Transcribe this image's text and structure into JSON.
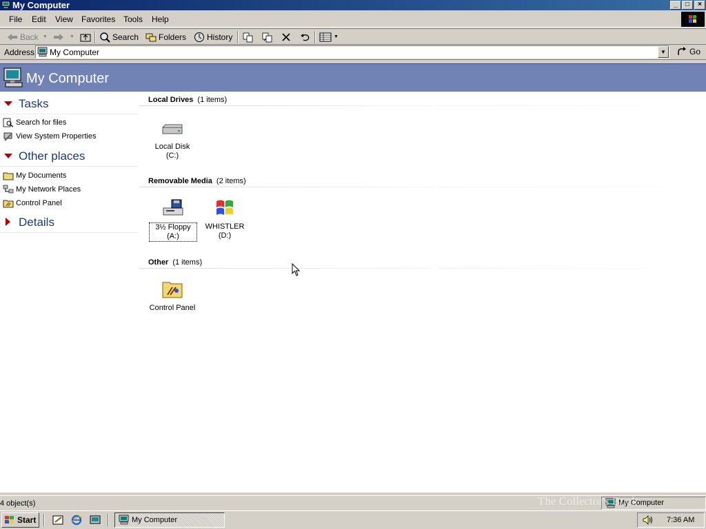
{
  "window": {
    "title": "My Computer",
    "min_label": "_",
    "max_label": "□",
    "close_label": "×"
  },
  "menu": [
    "File",
    "Edit",
    "View",
    "Favorites",
    "Tools",
    "Help"
  ],
  "toolbar": {
    "back_label": "Back",
    "search_label": "Search",
    "folders_label": "Folders",
    "history_label": "History"
  },
  "address": {
    "label": "Address",
    "value": "My Computer",
    "go_label": "Go"
  },
  "banner": {
    "title": "My Computer"
  },
  "sidebar": {
    "tasks_header": "Tasks",
    "tasks": [
      "Search for files",
      "View System Properties"
    ],
    "other_header": "Other places",
    "other": [
      "My Documents",
      "My Network Places",
      "Control Panel"
    ],
    "details_header": "Details"
  },
  "groups": {
    "local": {
      "title": "Local Drives",
      "count": "(1 items)",
      "items": [
        "Local Disk (C:)"
      ]
    },
    "removable": {
      "title": "Removable Media",
      "count": "(2 items)",
      "items": [
        "3½ Floppy (A:)",
        "WHISTLER (D:)"
      ]
    },
    "other": {
      "title": "Other",
      "count": "(1 items)",
      "items": [
        "Control Panel"
      ]
    }
  },
  "status": {
    "objects": "4 object(s)",
    "location": "My Computer"
  },
  "taskbar": {
    "start_label": "Start",
    "window_button": "My Computer",
    "clock": "7:36 AM"
  },
  "watermark": "The Collector's Book",
  "colors": {
    "banner": "#7183b5",
    "section_header": "#1c3a78",
    "arrow_red": "#b00000",
    "titlebar": "#0a246a"
  }
}
